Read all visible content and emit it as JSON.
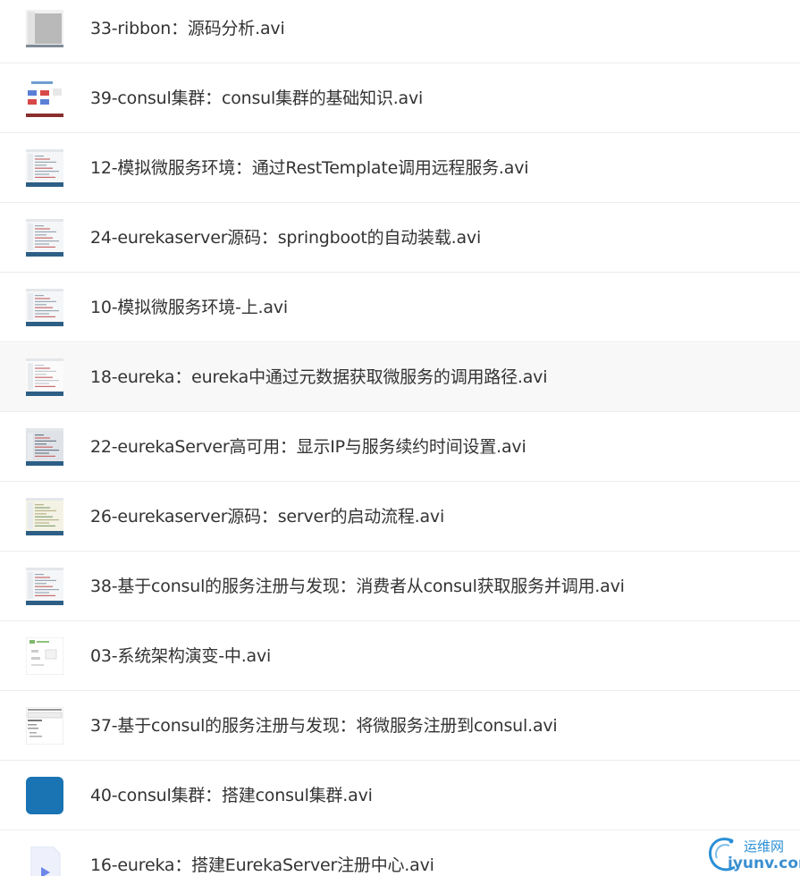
{
  "files": [
    {
      "name": "33-ribbon：源码分析.avi",
      "thumb": "gray-doc"
    },
    {
      "name": "39-consul集群：consul集群的基础知识.avi",
      "thumb": "diagram"
    },
    {
      "name": "12-模拟微服务环境：通过RestTemplate调用远程服务.avi",
      "thumb": "code-editor"
    },
    {
      "name": "24-eurekaserver源码：springboot的自动装载.avi",
      "thumb": "code-editor"
    },
    {
      "name": "10-模拟微服务环境-上.avi",
      "thumb": "code-editor"
    },
    {
      "name": "18-eureka：eureka中通过元数据获取微服务的调用路径.avi",
      "thumb": "code-editor-light"
    },
    {
      "name": "22-eurekaServer高可用：显示IP与服务续约时间设置.avi",
      "thumb": "code-editor-dark"
    },
    {
      "name": "26-eurekaserver源码：server的启动流程.avi",
      "thumb": "code-editor-yellow"
    },
    {
      "name": "38-基于consul的服务注册与发现：消费者从consul获取服务并调用.avi",
      "thumb": "code-editor"
    },
    {
      "name": "03-系统架构演变-中.avi",
      "thumb": "slide"
    },
    {
      "name": "37-基于consul的服务注册与发现：将微服务注册到consul.avi",
      "thumb": "table"
    },
    {
      "name": "40-consul集群：搭建consul集群.avi",
      "thumb": "blue-tile"
    },
    {
      "name": "16-eureka：搭建EurekaServer注册中心.avi",
      "thumb": "video-icon"
    }
  ],
  "watermark": {
    "cn": "运维网",
    "url": "iyunv.com",
    "accent": "#2b8fd6"
  },
  "colors": {
    "text": "#333333",
    "divider": "#ededed",
    "alt_row": "#f8f8f8",
    "editor_bar": "#2d5f86",
    "tile_blue": "#1a73b3"
  }
}
